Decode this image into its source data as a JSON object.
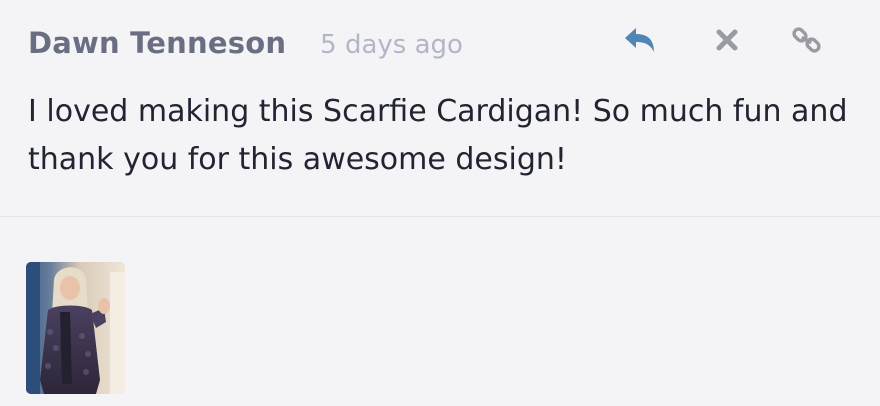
{
  "comment": {
    "author": "Dawn Tenneson",
    "timestamp": "5 days ago",
    "text": "I loved making this Scarfie Cardigan! So much fun and thank you for this awesome design!"
  },
  "actions": {
    "reply_icon": "reply-icon",
    "remove_icon": "close-icon",
    "link_icon": "link-icon"
  },
  "attachment": {
    "kind": "photo-thumbnail"
  },
  "colors": {
    "background": "#f4f4f7",
    "author": "#6a6e82",
    "timestamp": "#b3b6c7",
    "text": "#222431",
    "reply_icon": "#4f86b5",
    "action_icons": "#9a9aa2"
  }
}
